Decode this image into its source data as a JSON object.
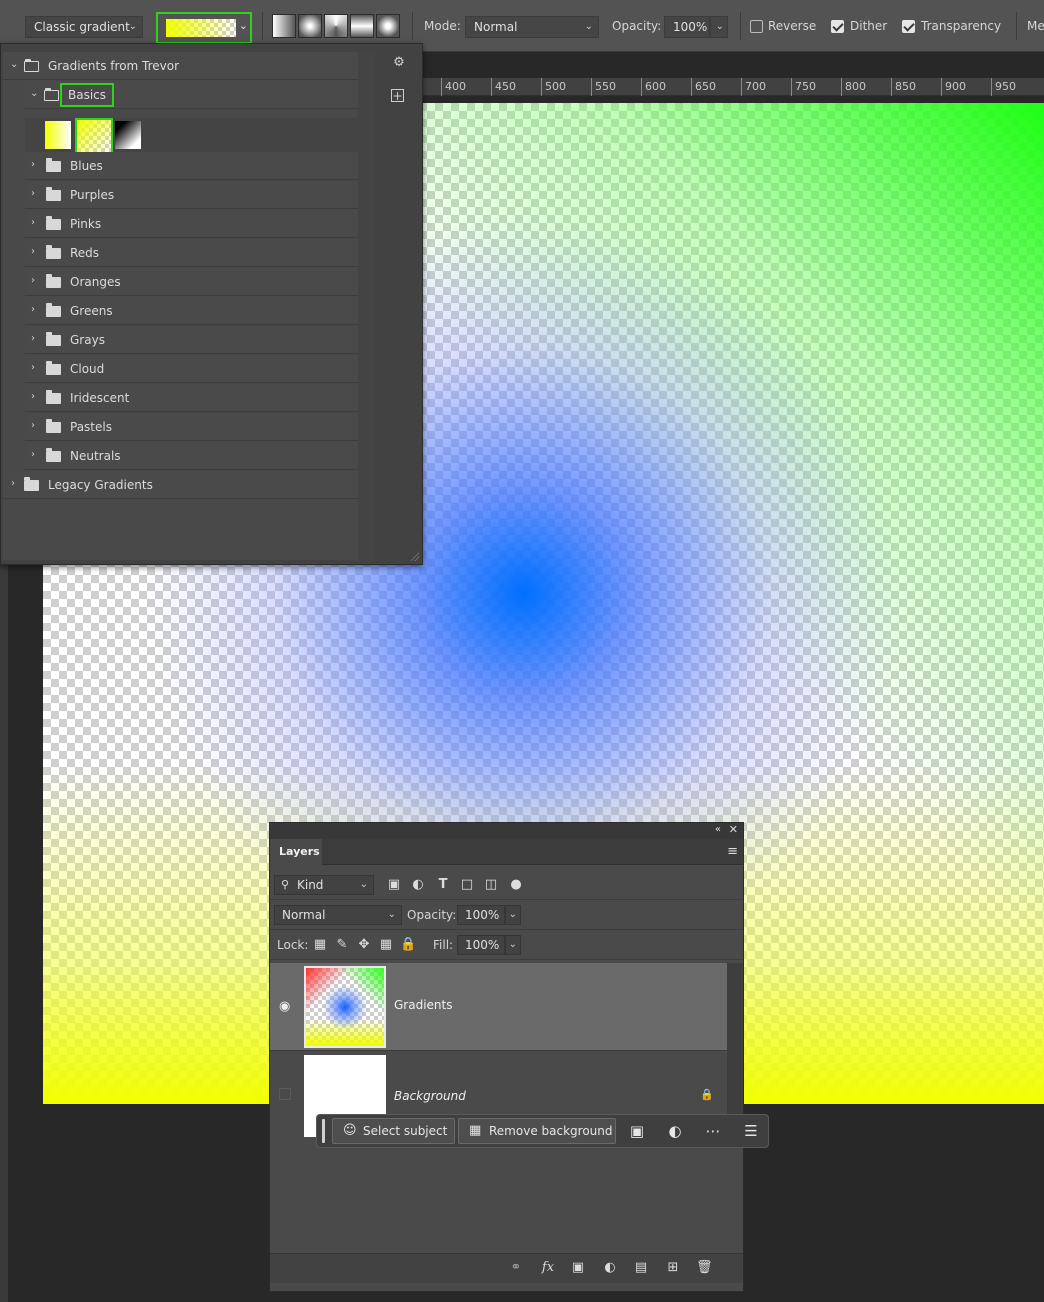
{
  "options_bar": {
    "gradient_style": "Classic gradient",
    "mode_label": "Mode:",
    "mode_value": "Normal",
    "opacity_label": "Opacity:",
    "opacity_value": "100%",
    "reverse_label": "Reverse",
    "reverse_checked": false,
    "dither_label": "Dither",
    "dither_checked": true,
    "transparency_label": "Transparency",
    "transparency_checked": true,
    "overflow_label": "Me"
  },
  "ruler": {
    "ticks": [
      "400",
      "450",
      "500",
      "550",
      "600",
      "650",
      "700",
      "750",
      "800",
      "850",
      "900",
      "950"
    ]
  },
  "gradient_picker": {
    "root_group": "Gradients from Trevor",
    "open_folder": "Basics",
    "folders": [
      "Blues",
      "Purples",
      "Pinks",
      "Reds",
      "Oranges",
      "Greens",
      "Grays",
      "Cloud",
      "Iridescent",
      "Pastels",
      "Neutrals"
    ],
    "legacy_group": "Legacy Gradients",
    "settings_icon": "gear-icon",
    "new_group_icon": "add-icon"
  },
  "layers_panel": {
    "tab_label": "Layers",
    "filter_kind": "Kind",
    "blend_mode": "Normal",
    "opacity_label": "Opacity:",
    "opacity_value": "100%",
    "lock_label": "Lock:",
    "fill_label": "Fill:",
    "fill_value": "100%",
    "layers": [
      {
        "name": "Gradients",
        "visible": true,
        "selected": true
      },
      {
        "name": "Background",
        "visible": false,
        "locked": true
      }
    ]
  },
  "task_bar": {
    "select_subject": "Select subject",
    "remove_background": "Remove background"
  },
  "colors": {
    "highlight": "#30d21e",
    "panel_bg": "#4a4a4a",
    "selected_layer": "#6a6a6a"
  }
}
